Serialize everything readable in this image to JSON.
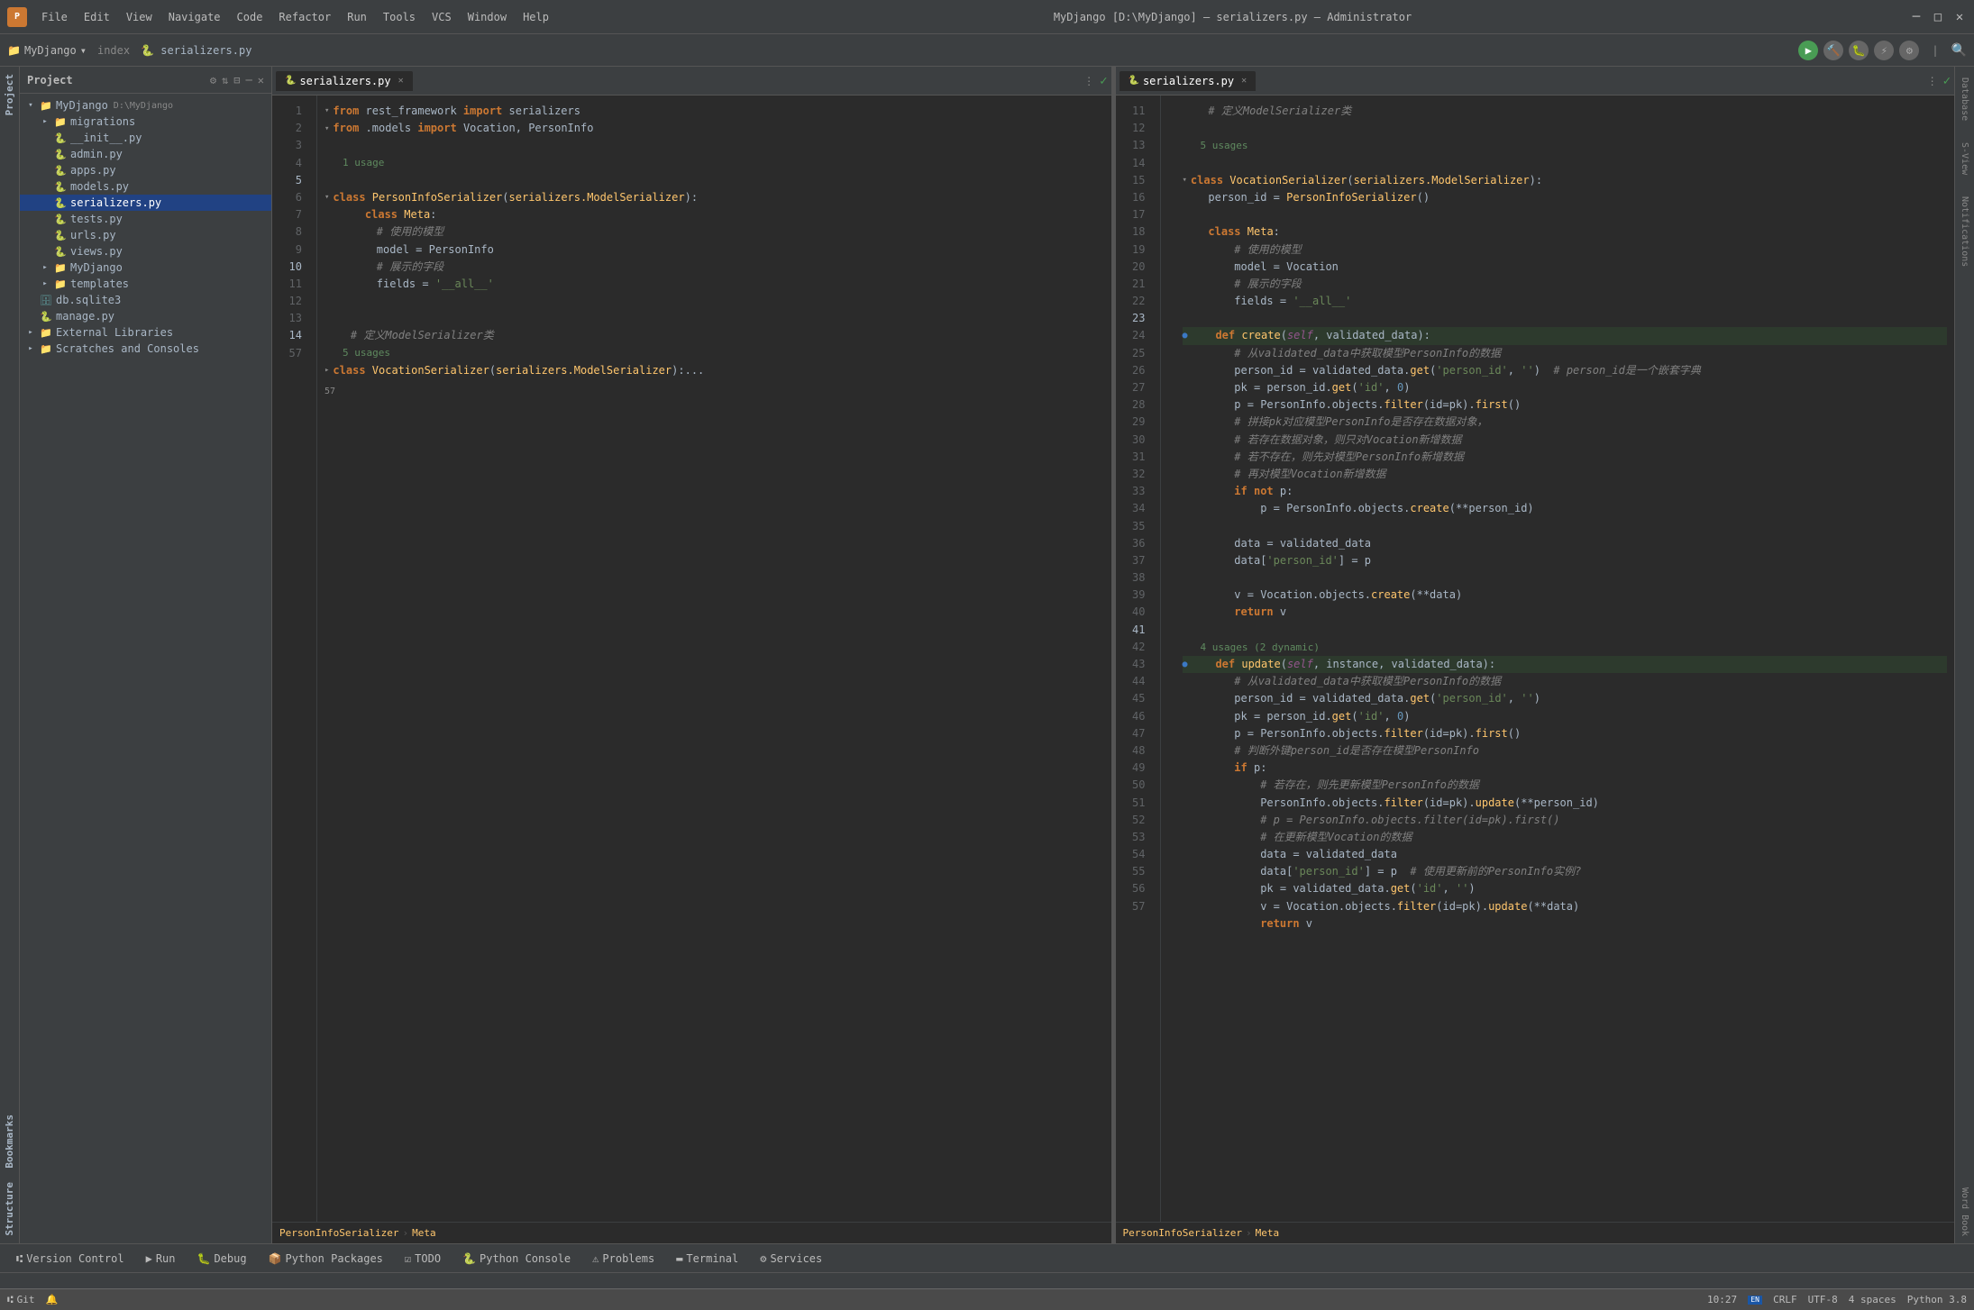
{
  "window": {
    "title": "MyDjango [D:\\MyDjango] – serializers.py – Administrator",
    "min_btn": "─",
    "max_btn": "□",
    "close_btn": "✕"
  },
  "menu": {
    "items": [
      "File",
      "Edit",
      "View",
      "Navigate",
      "Code",
      "Refactor",
      "Run",
      "Tools",
      "VCS",
      "Window",
      "Help"
    ]
  },
  "toolbar": {
    "project_name": "MyDjango",
    "index_tab": "index",
    "active_file": "serializers.py"
  },
  "project_panel": {
    "title": "Project",
    "root": {
      "name": "MyDjango",
      "path": "D:\\MyDjango",
      "children": [
        {
          "name": "migrations",
          "type": "folder",
          "expanded": false,
          "depth": 2
        },
        {
          "name": "__init__.py",
          "type": "python",
          "depth": 2
        },
        {
          "name": "admin.py",
          "type": "python",
          "depth": 2
        },
        {
          "name": "apps.py",
          "type": "python",
          "depth": 2
        },
        {
          "name": "models.py",
          "type": "python",
          "depth": 2
        },
        {
          "name": "serializers.py",
          "type": "python",
          "depth": 2,
          "active": true
        },
        {
          "name": "tests.py",
          "type": "python",
          "depth": 2
        },
        {
          "name": "urls.py",
          "type": "python",
          "depth": 2
        },
        {
          "name": "views.py",
          "type": "python",
          "depth": 2
        },
        {
          "name": "MyDjango",
          "type": "folder",
          "expanded": false,
          "depth": 1
        },
        {
          "name": "templates",
          "type": "folder",
          "expanded": false,
          "depth": 1
        },
        {
          "name": "db.sqlite3",
          "type": "db",
          "depth": 1
        },
        {
          "name": "manage.py",
          "type": "python",
          "depth": 1
        },
        {
          "name": "External Libraries",
          "type": "folder",
          "expanded": false,
          "depth": 0
        },
        {
          "name": "Scratches and Consoles",
          "type": "folder",
          "expanded": false,
          "depth": 0
        }
      ]
    }
  },
  "left_editor": {
    "tab": "serializers.py",
    "lines": [
      {
        "n": 1,
        "code": "from rest_framework import serializers",
        "type": "import"
      },
      {
        "n": 2,
        "code": "from .models import Vocation, PersonInfo",
        "type": "import"
      },
      {
        "n": 3,
        "code": "",
        "type": "empty"
      },
      {
        "n": 4,
        "code": "",
        "type": "empty"
      },
      {
        "n": 5,
        "code": "class PersonInfoSerializer(serializers.ModelSerializer):",
        "type": "class"
      },
      {
        "n": 6,
        "code": "    class Meta:",
        "type": "meta"
      },
      {
        "n": 7,
        "code": "        # 使用的模型",
        "type": "comment"
      },
      {
        "n": 8,
        "code": "        model = PersonInfo",
        "type": "assign"
      },
      {
        "n": 9,
        "code": "        # 展示的字段",
        "type": "comment"
      },
      {
        "n": 10,
        "code": "        fields = '__all__'",
        "type": "assign"
      },
      {
        "n": 11,
        "code": "",
        "type": "empty"
      },
      {
        "n": 12,
        "code": "",
        "type": "empty"
      },
      {
        "n": 13,
        "code": "    # 定义ModelSerializer类",
        "type": "comment"
      },
      {
        "n": 14,
        "code": "class VocationSerializer(serializers.ModelSerializer):...",
        "type": "class"
      }
    ],
    "usage_hints": [
      {
        "after_line": 4,
        "text": "1 usage"
      },
      {
        "after_line": 13,
        "text": "5 usages"
      }
    ],
    "breadcrumb": [
      "PersonInfoSerializer",
      "Meta"
    ]
  },
  "right_editor": {
    "tab": "serializers.py",
    "lines": [
      {
        "n": 11,
        "code": "    # 定义ModelSerializer类"
      },
      {
        "n": 12,
        "code": ""
      },
      {
        "n": 13,
        "code": ""
      },
      {
        "n": 14,
        "code": "class VocationSerializer(serializers.ModelSerializer):"
      },
      {
        "n": 15,
        "code": "    person_id = PersonInfoSerializer()"
      },
      {
        "n": 16,
        "code": ""
      },
      {
        "n": 17,
        "code": "    class Meta:"
      },
      {
        "n": 18,
        "code": "        # 使用的模型"
      },
      {
        "n": 19,
        "code": "        model = Vocation"
      },
      {
        "n": 20,
        "code": "        # 展示的字段"
      },
      {
        "n": 21,
        "code": "        fields = '__all__'"
      },
      {
        "n": 22,
        "code": ""
      },
      {
        "n": 23,
        "code": "    def create(self, validated_data):"
      },
      {
        "n": 24,
        "code": "        # 从validated_data中获取模型PersonInfo的数据"
      },
      {
        "n": 25,
        "code": "        person_id = validated_data.get('person_id', '')  # person_id是一个嵌套字典"
      },
      {
        "n": 26,
        "code": "        pk = person_id.get('id', 0)"
      },
      {
        "n": 27,
        "code": "        p = PersonInfo.objects.filter(id=pk).first()"
      },
      {
        "n": 28,
        "code": "        # 拼接pk对应模型PersonInfo是否存在数据对象，"
      },
      {
        "n": 29,
        "code": "        # 若存在数据对象，则只对Vocation新增数据"
      },
      {
        "n": 30,
        "code": "        # 若不存在，则先对模型PersonInfo新增数据"
      },
      {
        "n": 31,
        "code": "        # 再对模型Vocation新增数据"
      },
      {
        "n": 32,
        "code": "        if not p:"
      },
      {
        "n": 33,
        "code": "            p = PersonInfo.objects.create(**person_id)"
      },
      {
        "n": 34,
        "code": ""
      },
      {
        "n": 35,
        "code": "        data = validated_data"
      },
      {
        "n": 36,
        "code": "        data['person_id'] = p"
      },
      {
        "n": 37,
        "code": ""
      },
      {
        "n": 38,
        "code": "        v = Vocation.objects.create(**data)"
      },
      {
        "n": 39,
        "code": "        return v"
      },
      {
        "n": 40,
        "code": ""
      },
      {
        "n": 41,
        "code": "    def update(self, instance, validated_data):"
      },
      {
        "n": 42,
        "code": "        # 从validated_data中获取模型PersonInfo的数据"
      },
      {
        "n": 43,
        "code": "        person_id = validated_data.get('person_id', '')"
      },
      {
        "n": 44,
        "code": "        pk = person_id.get('id', 0)"
      },
      {
        "n": 45,
        "code": "        p = PersonInfo.objects.filter(id=pk).first()"
      },
      {
        "n": 46,
        "code": "        # 判断外键person_id是否存在模型PersonInfo"
      },
      {
        "n": 47,
        "code": "        if p:"
      },
      {
        "n": 48,
        "code": "            # 若存在，则先更新模型PersonInfo的数据"
      },
      {
        "n": 49,
        "code": "            PersonInfo.objects.filter(id=pk).update(**person_id)"
      },
      {
        "n": 50,
        "code": "            # p = PersonInfo.objects.filter(id=pk).first()"
      },
      {
        "n": 51,
        "code": "            # 在更新模型Vocation的数据"
      },
      {
        "n": 52,
        "code": "            data = validated_data"
      },
      {
        "n": 53,
        "code": "            data['person_id'] = p  # 使用更新前的PersonInfo实例?"
      },
      {
        "n": 54,
        "code": "            pk = validated_data.get('id', '')"
      },
      {
        "n": 55,
        "code": "            v = Vocation.objects.filter(id=pk).update(**data)"
      },
      {
        "n": 56,
        "code": "            return v"
      },
      {
        "n": 57,
        "code": ""
      }
    ],
    "usage_hints": [
      {
        "after_line": 13,
        "text": "5 usages"
      },
      {
        "after_line": 40,
        "text": "4 usages (2 dynamic)"
      }
    ],
    "breadcrumb": [
      "PersonInfoSerializer",
      "Meta"
    ]
  },
  "bottom_tabs": [
    {
      "label": "Version Control",
      "icon": "⑆",
      "active": false
    },
    {
      "label": "Run",
      "icon": "▶",
      "active": false
    },
    {
      "label": "Debug",
      "icon": "🐛",
      "active": false
    },
    {
      "label": "Python Packages",
      "icon": "📦",
      "active": false
    },
    {
      "label": "TODO",
      "icon": "☑",
      "active": false
    },
    {
      "label": "Python Console",
      "icon": "🐍",
      "active": false
    },
    {
      "label": "Problems",
      "icon": "⚠",
      "active": false
    },
    {
      "label": "Terminal",
      "icon": "▬",
      "active": false
    },
    {
      "label": "Services",
      "icon": "⚙",
      "active": false
    }
  ],
  "status_bar": {
    "vcs": "Git",
    "time": "10:27",
    "encoding": "CRLF",
    "charset": "UTF-8",
    "indent": "4 spaces",
    "python": "Python 3.8"
  },
  "right_panels": [
    "Database",
    "S-View",
    "Notifications",
    "Word Book"
  ],
  "left_panels": [
    "Project",
    "Bookmarks",
    "Structure"
  ]
}
